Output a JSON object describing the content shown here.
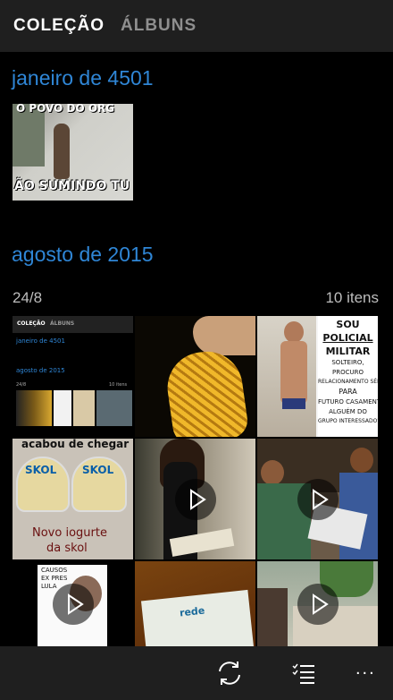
{
  "tabs": {
    "collection": "COLEÇÃO",
    "albums": "ÁLBUNS"
  },
  "sections": [
    {
      "title": "janeiro de 4501",
      "photo_caption_top": "O POVO DO ORG",
      "photo_caption_bottom": "ÃO SUMINDO TU"
    },
    {
      "title": "agosto de 2015",
      "date": "24/8",
      "count": "10 itens"
    }
  ],
  "thumbnails": {
    "screenshot": {
      "tab1": "COLEÇÃO",
      "tab2": "ÁLBUNS",
      "title1": "janeiro de 4501",
      "title2": "agosto de 2015",
      "date": "24/8",
      "count": "10 itens"
    },
    "policial": {
      "lines": [
        "SOU",
        "POLICIAL",
        "MILITAR",
        "SOLTEIRO,",
        "PROCURO",
        "RELACIONAMENTO SÉRIO",
        "PARA",
        "FUTURO CASAMENTO",
        "ALGUÉM DO",
        "GRUPO INTERESSADO??"
      ]
    },
    "skol": {
      "top": "acabou de chegar",
      "brand1": "SKOL",
      "brand2": "SKOL",
      "bottom1": "Novo iogurte",
      "bottom2": "da skol"
    },
    "lula": {
      "lines": [
        "CAUSOS",
        "EX PRES",
        "LULA"
      ]
    },
    "receipt": {
      "text": "rede"
    }
  },
  "appbar": {
    "sync_icon": "sync-icon",
    "select_icon": "select-list-icon",
    "more_label": "..."
  },
  "colors": {
    "accent": "#2f86d6",
    "header_bg": "#1f1f1f",
    "background": "#000000"
  }
}
